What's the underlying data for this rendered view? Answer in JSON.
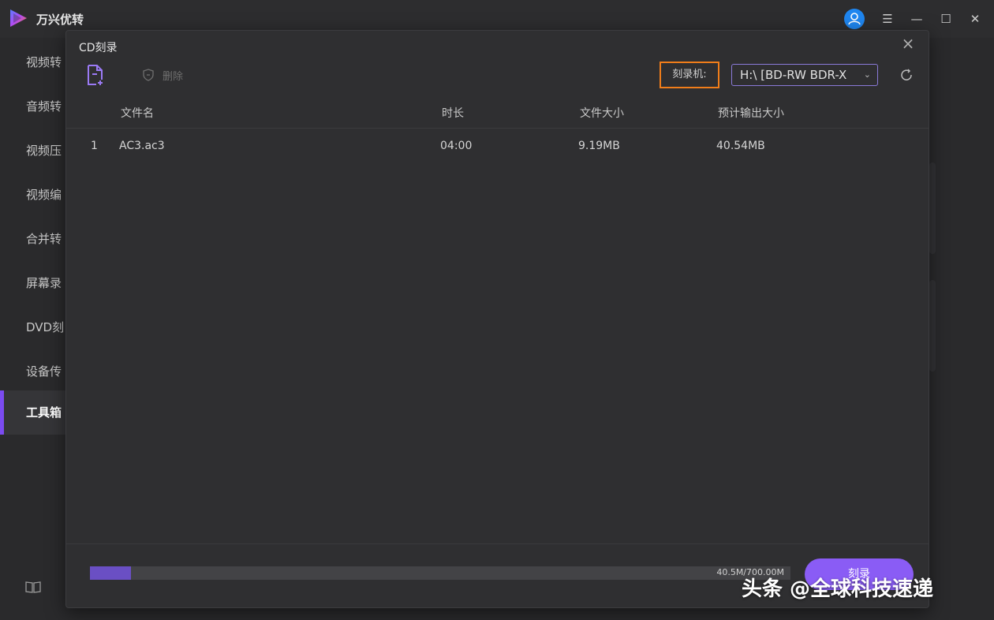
{
  "app": {
    "title": "万兴优转"
  },
  "sidebar": {
    "items": [
      {
        "label": "视频转"
      },
      {
        "label": "音频转"
      },
      {
        "label": "视频压"
      },
      {
        "label": "视频编"
      },
      {
        "label": "合并转"
      },
      {
        "label": "屏幕录"
      },
      {
        "label": "DVD刻"
      },
      {
        "label": "设备传"
      },
      {
        "label": "工具箱"
      }
    ]
  },
  "modal": {
    "title": "CD刻录",
    "toolbar": {
      "delete_label": "删除",
      "burner_label": "刻录机:",
      "drive_value": "H:\\ [BD-RW   BDR-X"
    },
    "table": {
      "headers": {
        "name": "文件名",
        "duration": "时长",
        "size": "文件大小",
        "output_size": "预计输出大小"
      },
      "rows": [
        {
          "index": "1",
          "name": "AC3.ac3",
          "duration": "04:00",
          "size": "9.19MB",
          "output_size": "40.54MB"
        }
      ]
    },
    "footer": {
      "progress_text": "40.5M/700.00M",
      "progress_fraction": 0.058,
      "burn_label": "刻录"
    }
  },
  "watermark": {
    "text": "头条 @全球科技速递"
  },
  "colors": {
    "accent": "#8a5cf5",
    "highlight_box": "#f07d1a",
    "avatar": "#1f86f0"
  },
  "icons": [
    "app-logo-icon",
    "user-icon",
    "menu-icon",
    "minimize-icon",
    "maximize-icon",
    "close-icon",
    "add-file-icon",
    "shield-delete-icon",
    "chevron-down-icon",
    "refresh-icon",
    "book-icon"
  ]
}
